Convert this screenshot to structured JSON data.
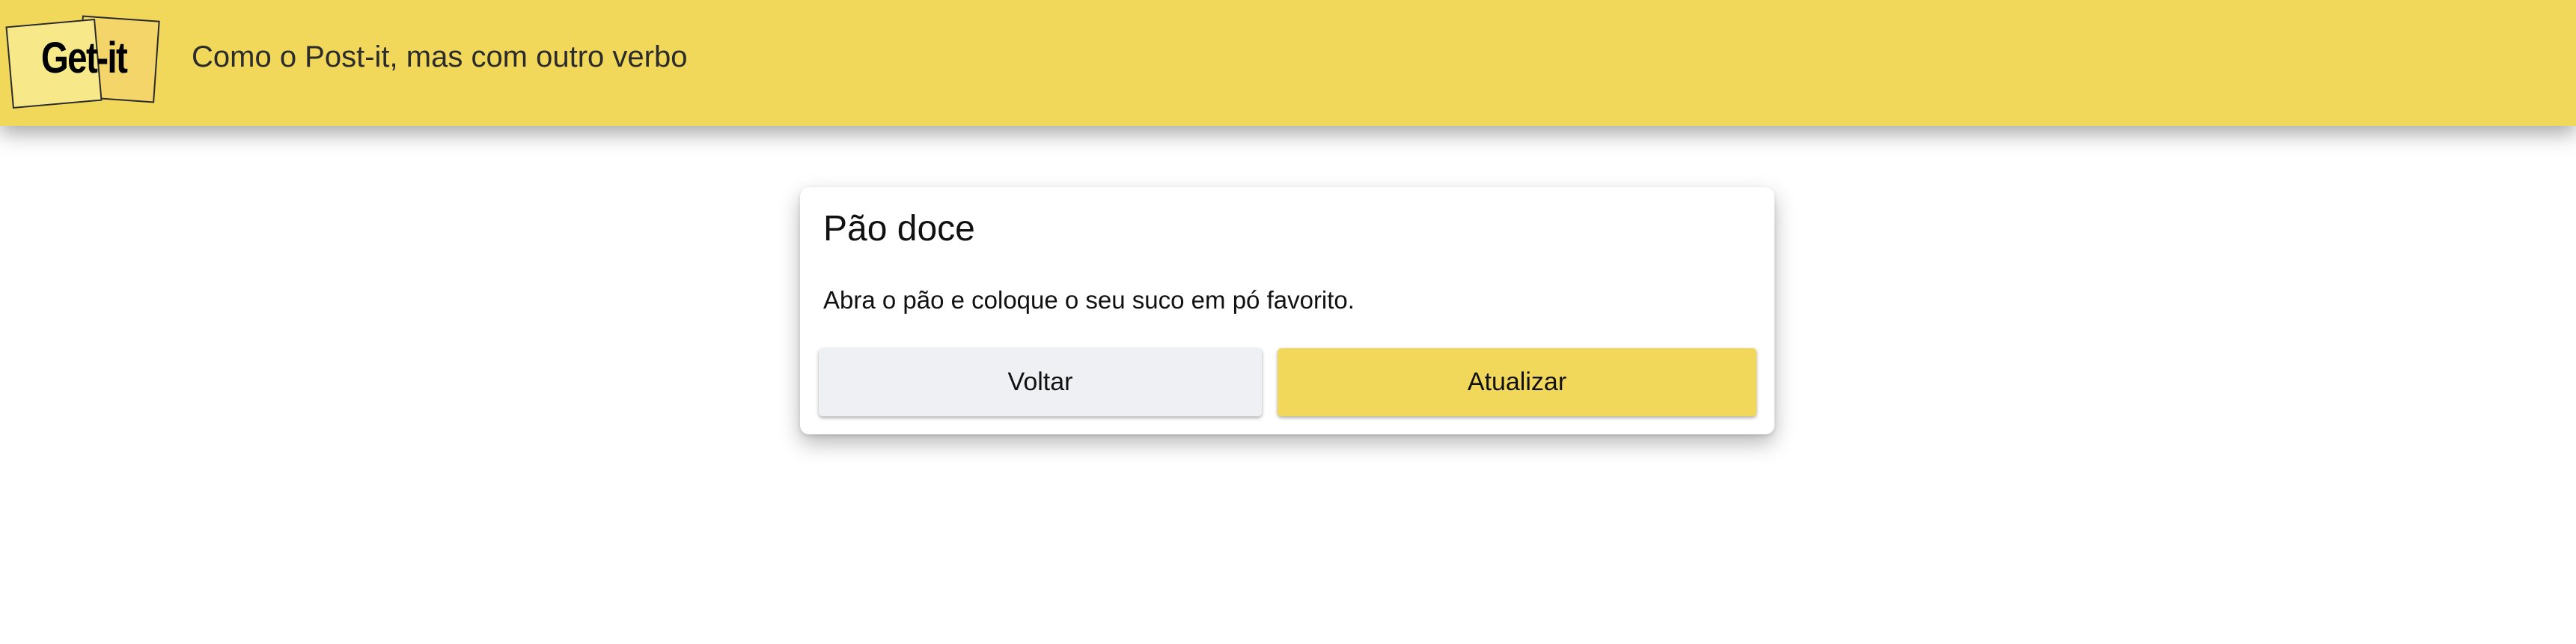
{
  "header": {
    "logo_text": "Get-it",
    "tagline": "Como o Post-it, mas com outro verbo",
    "background_color": "#f1d85b"
  },
  "note_card": {
    "title": "Pão doce",
    "content": "Abra o pão e coloque o seu suco em pó favorito.",
    "back_button_label": "Voltar",
    "update_button_label": "Atualizar",
    "update_button_color": "#f1d85b",
    "back_button_color": "#eef0f3"
  }
}
